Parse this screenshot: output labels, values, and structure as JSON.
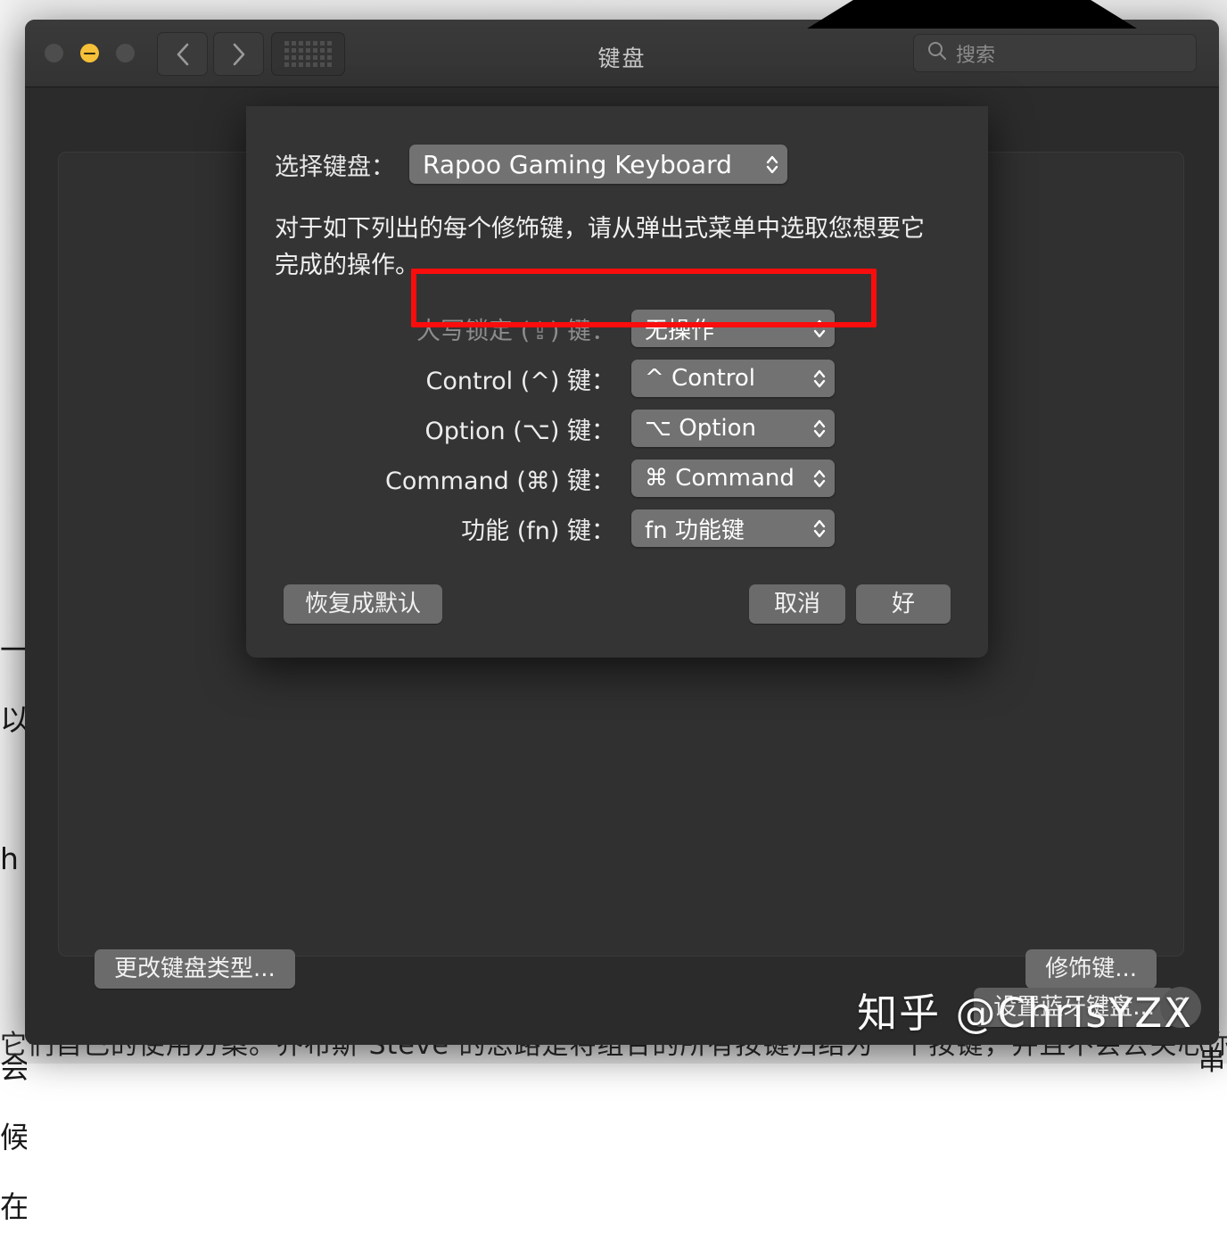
{
  "background": {
    "left_text": "一\n以\n\nh\n\n\n会\n候\n在",
    "right_text": "\n\n串",
    "bottom_text": "它们自己的使用方案。乔布斯 Steve 的思路是将组合的所有按键归结为一个按键，并且不会去关心你"
  },
  "window": {
    "title": "键盘",
    "traffic_lights": [
      {
        "name": "close",
        "color": "#4d4d4d"
      },
      {
        "name": "minimize",
        "color": "#f6c039"
      },
      {
        "name": "zoom",
        "color": "#4d4d4d"
      }
    ],
    "nav": {
      "back_icon": "chevron-left-icon",
      "forward_icon": "chevron-right-icon",
      "grid_icon": "grid-dots-icon"
    },
    "search": {
      "icon": "search-icon",
      "placeholder": "搜索",
      "value": ""
    },
    "footer": {
      "change_keyboard_type": "更改键盘类型...",
      "modifier_keys": "修饰键...",
      "setup_bluetooth_keyboard": "设置蓝牙键盘...",
      "help": "?"
    }
  },
  "sheet": {
    "select_keyboard_label": "选择键盘：",
    "selected_keyboard": "Rapoo Gaming Keyboard",
    "description": "对于如下列出的每个修饰键，请从弹出式菜单中选取您想要它完成的操作。",
    "rows": [
      {
        "label": "大写锁定 (⇪) 键：",
        "value": "无操作",
        "disabled": true,
        "highlighted": true
      },
      {
        "label": "Control (^) 键：",
        "value": "^ Control",
        "disabled": false,
        "highlighted": false
      },
      {
        "label": "Option (⌥) 键：",
        "value": "⌥ Option",
        "disabled": false,
        "highlighted": false
      },
      {
        "label": "Command (⌘) 键：",
        "value": "⌘ Command",
        "disabled": false,
        "highlighted": false
      },
      {
        "label": "功能 (fn) 键：",
        "value": "fn 功能键",
        "disabled": false,
        "highlighted": false
      }
    ],
    "buttons": {
      "restore_defaults": "恢复成默认",
      "cancel": "取消",
      "ok": "好"
    }
  },
  "annotation": {
    "highlight_color": "#fa0d0d"
  },
  "watermark": {
    "text": "知乎 @ChrisYZX"
  }
}
